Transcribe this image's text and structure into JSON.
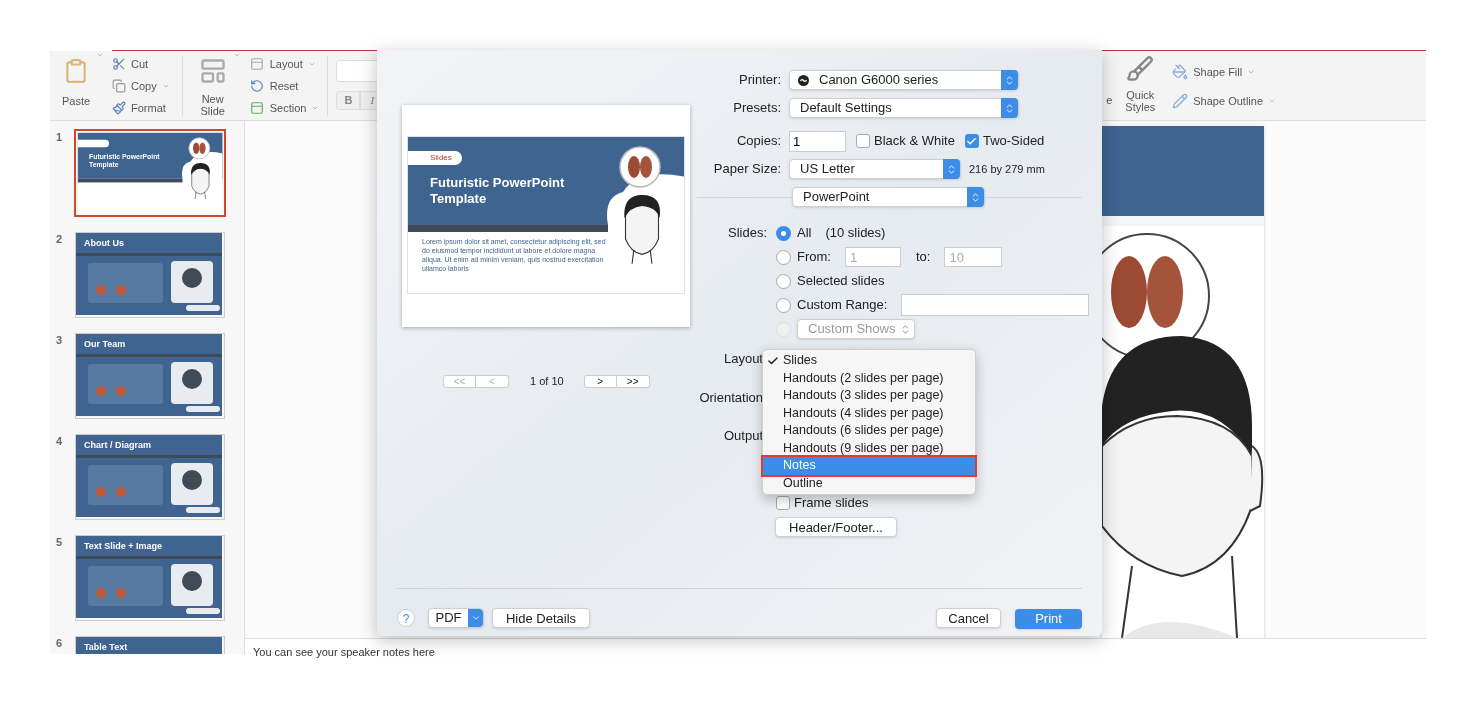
{
  "ribbon": {
    "paste": "Paste",
    "cut": "Cut",
    "copy": "Copy",
    "format": "Format",
    "new_slide": "New Slide",
    "layout": "Layout",
    "reset": "Reset",
    "section": "Section",
    "bold": "B",
    "italic": "I",
    "partial_label": "e",
    "quick_styles": "Quick Styles",
    "shape_fill": "Shape Fill",
    "shape_outline": "Shape Outline"
  },
  "slides": [
    {
      "number": "1",
      "title": "Futuristic PowerPoint Template",
      "kind": "title",
      "selected": true
    },
    {
      "number": "2",
      "title": "About Us",
      "kind": "content",
      "selected": false
    },
    {
      "number": "3",
      "title": "Our Team",
      "kind": "content",
      "selected": false
    },
    {
      "number": "4",
      "title": "Chart / Diagram",
      "kind": "content",
      "selected": false
    },
    {
      "number": "5",
      "title": "Text Slide + Image",
      "kind": "content",
      "selected": false
    },
    {
      "number": "6",
      "title": "Table Text",
      "kind": "content",
      "selected": false
    }
  ],
  "notes_text": "You can see your speaker notes here",
  "print_dialog": {
    "preview": {
      "logo": "Slides",
      "title": "Futuristic PowerPoint Template",
      "body": "Lorem ipsum dolor sit amet, consectetur adipiscing elit, sed do eiusmod tempor incididunt ut labore et dolore magna aliqua. Ut enim ad minim veniam, quis nostrud exercitation ullamco laboris"
    },
    "pager": {
      "first": "<<",
      "prev": "<",
      "page": "1 of 10",
      "next": ">",
      "last": ">>"
    },
    "printer": {
      "label": "Printer:",
      "value": "Canon G6000 series"
    },
    "presets": {
      "label": "Presets:",
      "value": "Default Settings"
    },
    "copies": {
      "label": "Copies:",
      "value": "1"
    },
    "options": [
      {
        "label": "Black & White",
        "checked": false
      },
      {
        "label": "Two-Sided",
        "checked": true
      }
    ],
    "paper_size": {
      "label": "Paper Size:",
      "value": "US Letter",
      "dimensions": "216 by 279 mm"
    },
    "section": "PowerPoint",
    "slides_label": "Slides:",
    "range_options": [
      {
        "kind": "all",
        "label": "All",
        "detail": "(10 slides)",
        "selected": true,
        "disabled": false
      },
      {
        "kind": "from",
        "label": "From:",
        "from_placeholder": "1",
        "to_label": "to:",
        "to_placeholder": "10",
        "selected": false,
        "disabled": false
      },
      {
        "kind": "plain",
        "label": "Selected slides",
        "selected": false,
        "disabled": false
      },
      {
        "kind": "custom_range",
        "label": "Custom Range:",
        "selected": false,
        "disabled": false
      },
      {
        "kind": "custom_shows",
        "label": "Custom Shows",
        "selected": false,
        "disabled": true
      }
    ],
    "layout_label": "Layout",
    "orientation_label": "Orientation",
    "output_label": "Output",
    "layout_menu": [
      {
        "label": "Slides",
        "selected": true,
        "highlighted": false,
        "annotated": false
      },
      {
        "label": "Handouts (2 slides per page)",
        "selected": false,
        "highlighted": false,
        "annotated": false
      },
      {
        "label": "Handouts (3 slides per page)",
        "selected": false,
        "highlighted": false,
        "annotated": false
      },
      {
        "label": "Handouts (4 slides per page)",
        "selected": false,
        "highlighted": false,
        "annotated": false
      },
      {
        "label": "Handouts (6 slides per page)",
        "selected": false,
        "highlighted": false,
        "annotated": false
      },
      {
        "label": "Handouts (9 slides per page)",
        "selected": false,
        "highlighted": false,
        "annotated": false
      },
      {
        "label": "Notes",
        "selected": false,
        "highlighted": true,
        "annotated": true
      },
      {
        "label": "Outline",
        "selected": false,
        "highlighted": false,
        "annotated": false
      }
    ],
    "frame_slides": {
      "label": "Frame slides",
      "checked": false
    },
    "header_footer": "Header/Footer...",
    "help": "?",
    "pdf": "PDF",
    "hide_details": "Hide Details",
    "cancel": "Cancel",
    "print": "Print"
  }
}
